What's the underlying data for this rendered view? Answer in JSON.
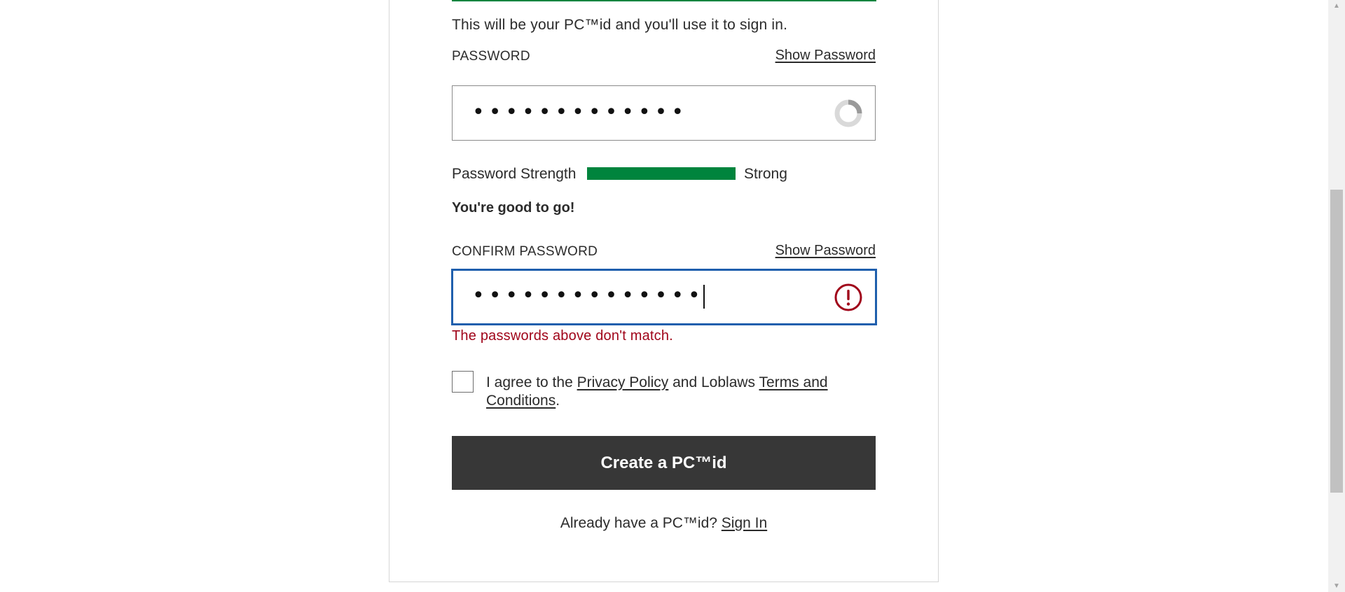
{
  "email": {
    "helper_text": "This will be your PC™id and you'll use it to sign in."
  },
  "password": {
    "label": "PASSWORD",
    "show_label": "Show Password",
    "masked_value": "•••••••••••••",
    "status_icon": "loading-spinner-icon"
  },
  "strength": {
    "label": "Password Strength",
    "value_text": "Strong",
    "level": 1.0,
    "color": "#00843d",
    "message": "You're good to go!"
  },
  "confirm_password": {
    "label": "CONFIRM PASSWORD",
    "show_label": "Show Password",
    "masked_value": "••••••••••••••",
    "status_icon": "error-exclamation-icon",
    "error_text": "The passwords above don't match.",
    "error_color": "#a0051a",
    "focus_color": "#1f5fad"
  },
  "agreement": {
    "checked": false,
    "prefix": "I agree to the ",
    "privacy_link": "Privacy Policy",
    "middle": " and Loblaws ",
    "terms_link": "Terms and Conditions",
    "suffix": "."
  },
  "create_button": {
    "label": "Create a PC™id"
  },
  "signin": {
    "prompt": "Already have a PC™id? ",
    "link": "Sign In"
  }
}
